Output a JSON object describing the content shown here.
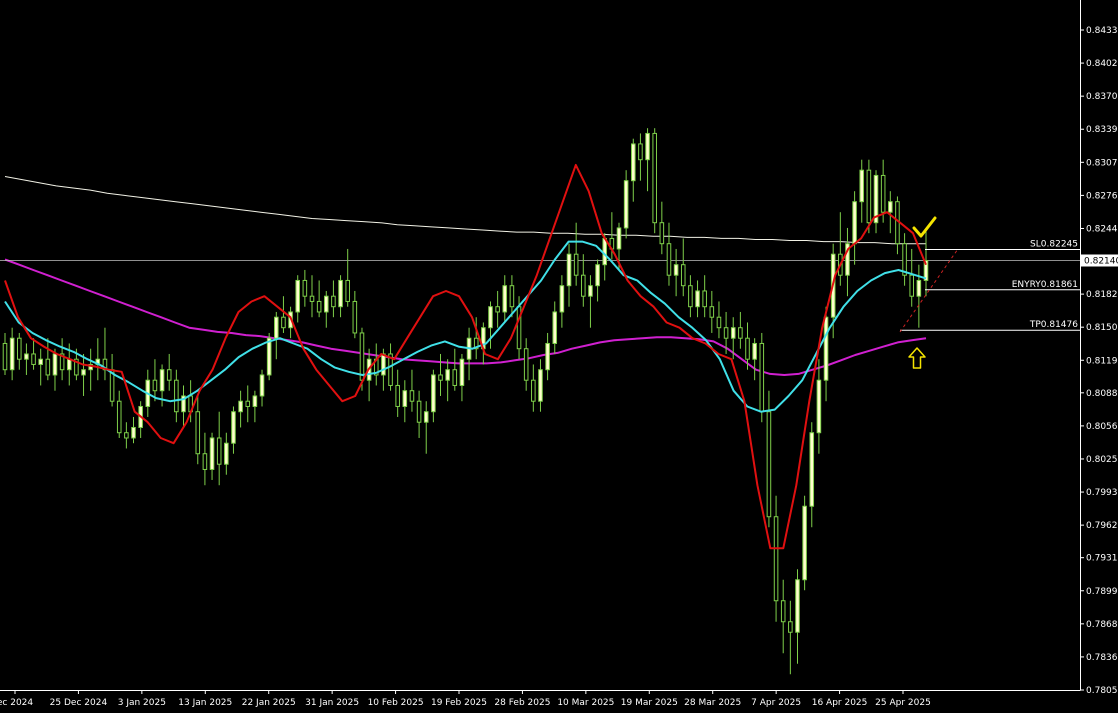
{
  "chart_data": {
    "type": "candlestick",
    "background": "#000000",
    "colors": {
      "bull_body": "#ffffcc",
      "bear_body": "#000000",
      "wick": "#7fd04a",
      "axis": "#ffffff",
      "ma_fast": "#e01010",
      "ma_mid": "#40e0e8",
      "ma_slow": "#d020d0",
      "ma_long": "#f2f2e6",
      "level_line": "#ffffff",
      "current_price_line": "#c0c0c0",
      "arrow": "#f5e400",
      "check": "#f5e400",
      "trend_dash": "#cc2222"
    },
    "price_axis": {
      "ticks": [
        "0.84335",
        "0.84020",
        "0.83705",
        "0.83390",
        "0.83075",
        "0.82760",
        "0.82445",
        "0.82140",
        "0.81820",
        "0.81505",
        "0.81190",
        "0.80880",
        "0.80565",
        "0.80250",
        "0.79935",
        "0.79620",
        "0.79310",
        "0.78995",
        "0.78680",
        "0.78365",
        "0.78050"
      ],
      "ylim": [
        0.7805,
        0.84335
      ]
    },
    "date_axis": {
      "ticks": [
        "ec 2024",
        "25 Dec 2024",
        "3 Jan 2025",
        "13 Jan 2025",
        "22 Jan 2025",
        "31 Jan 2025",
        "10 Feb 2025",
        "19 Feb 2025",
        "28 Feb 2025",
        "10 Mar 2025",
        "19 Mar 2025",
        "28 Mar 2025",
        "7 Apr 2025",
        "16 Apr 2025",
        "25 Apr 2025"
      ]
    },
    "current_price": "0.82140",
    "levels": [
      {
        "label": "SL0.82245",
        "value": 0.82245
      },
      {
        "label": "ENYRY0.81861",
        "value": 0.81861
      },
      {
        "label": "TP0.81476",
        "value": 0.81476
      }
    ],
    "candles": [
      [
        0.8135,
        0.8145,
        0.8105,
        0.811
      ],
      [
        0.811,
        0.815,
        0.81,
        0.814
      ],
      [
        0.814,
        0.8145,
        0.811,
        0.812
      ],
      [
        0.812,
        0.8135,
        0.8105,
        0.8125
      ],
      [
        0.8125,
        0.814,
        0.811,
        0.8115
      ],
      [
        0.8115,
        0.813,
        0.8095,
        0.812
      ],
      [
        0.812,
        0.814,
        0.81,
        0.8105
      ],
      [
        0.8105,
        0.813,
        0.809,
        0.8125
      ],
      [
        0.8125,
        0.814,
        0.81,
        0.811
      ],
      [
        0.811,
        0.8135,
        0.8095,
        0.812
      ],
      [
        0.812,
        0.813,
        0.81,
        0.8105
      ],
      [
        0.8105,
        0.8125,
        0.8085,
        0.811
      ],
      [
        0.811,
        0.813,
        0.809,
        0.8115
      ],
      [
        0.8115,
        0.814,
        0.81,
        0.812
      ],
      [
        0.812,
        0.815,
        0.81,
        0.811
      ],
      [
        0.811,
        0.8125,
        0.8075,
        0.808
      ],
      [
        0.808,
        0.809,
        0.8045,
        0.805
      ],
      [
        0.805,
        0.806,
        0.8035,
        0.8045
      ],
      [
        0.8045,
        0.8065,
        0.804,
        0.8055
      ],
      [
        0.8055,
        0.808,
        0.8045,
        0.8075
      ],
      [
        0.8075,
        0.811,
        0.8065,
        0.81
      ],
      [
        0.81,
        0.812,
        0.808,
        0.809
      ],
      [
        0.809,
        0.8115,
        0.8075,
        0.811
      ],
      [
        0.811,
        0.8125,
        0.809,
        0.81
      ],
      [
        0.81,
        0.811,
        0.806,
        0.807
      ],
      [
        0.807,
        0.8095,
        0.8055,
        0.8085
      ],
      [
        0.8085,
        0.81,
        0.806,
        0.807
      ],
      [
        0.807,
        0.8085,
        0.802,
        0.803
      ],
      [
        0.803,
        0.805,
        0.8,
        0.8015
      ],
      [
        0.8015,
        0.805,
        0.8005,
        0.8045
      ],
      [
        0.8045,
        0.807,
        0.8,
        0.802
      ],
      [
        0.802,
        0.805,
        0.801,
        0.804
      ],
      [
        0.804,
        0.8075,
        0.803,
        0.807
      ],
      [
        0.807,
        0.809,
        0.8055,
        0.808
      ],
      [
        0.808,
        0.8095,
        0.806,
        0.8075
      ],
      [
        0.8075,
        0.809,
        0.806,
        0.8085
      ],
      [
        0.8085,
        0.811,
        0.8075,
        0.8105
      ],
      [
        0.8105,
        0.8145,
        0.81,
        0.814
      ],
      [
        0.814,
        0.8165,
        0.812,
        0.816
      ],
      [
        0.816,
        0.818,
        0.8145,
        0.815
      ],
      [
        0.815,
        0.817,
        0.814,
        0.8165
      ],
      [
        0.8165,
        0.82,
        0.8155,
        0.8195
      ],
      [
        0.8195,
        0.8205,
        0.817,
        0.818
      ],
      [
        0.818,
        0.82,
        0.816,
        0.8175
      ],
      [
        0.8175,
        0.8195,
        0.816,
        0.8165
      ],
      [
        0.8165,
        0.8185,
        0.815,
        0.818
      ],
      [
        0.818,
        0.8195,
        0.816,
        0.817
      ],
      [
        0.817,
        0.82,
        0.816,
        0.8195
      ],
      [
        0.8195,
        0.8225,
        0.817,
        0.8175
      ],
      [
        0.8175,
        0.8185,
        0.814,
        0.8145
      ],
      [
        0.8145,
        0.815,
        0.809,
        0.81
      ],
      [
        0.81,
        0.813,
        0.808,
        0.812
      ],
      [
        0.812,
        0.8135,
        0.8095,
        0.8105
      ],
      [
        0.8105,
        0.813,
        0.809,
        0.8125
      ],
      [
        0.8125,
        0.8135,
        0.809,
        0.8095
      ],
      [
        0.8095,
        0.811,
        0.8065,
        0.8075
      ],
      [
        0.8075,
        0.81,
        0.806,
        0.809
      ],
      [
        0.809,
        0.811,
        0.807,
        0.808
      ],
      [
        0.808,
        0.809,
        0.8045,
        0.806
      ],
      [
        0.806,
        0.808,
        0.803,
        0.807
      ],
      [
        0.807,
        0.811,
        0.806,
        0.8105
      ],
      [
        0.8105,
        0.8125,
        0.8085,
        0.81
      ],
      [
        0.81,
        0.812,
        0.808,
        0.811
      ],
      [
        0.811,
        0.813,
        0.809,
        0.8095
      ],
      [
        0.8095,
        0.8125,
        0.808,
        0.812
      ],
      [
        0.812,
        0.815,
        0.81,
        0.814
      ],
      [
        0.814,
        0.816,
        0.812,
        0.813
      ],
      [
        0.813,
        0.8155,
        0.8115,
        0.815
      ],
      [
        0.815,
        0.8175,
        0.813,
        0.817
      ],
      [
        0.817,
        0.8185,
        0.815,
        0.8165
      ],
      [
        0.8165,
        0.82,
        0.8155,
        0.819
      ],
      [
        0.819,
        0.82,
        0.816,
        0.817
      ],
      [
        0.817,
        0.818,
        0.812,
        0.813
      ],
      [
        0.813,
        0.814,
        0.809,
        0.81
      ],
      [
        0.81,
        0.8115,
        0.807,
        0.808
      ],
      [
        0.808,
        0.812,
        0.807,
        0.811
      ],
      [
        0.811,
        0.8145,
        0.81,
        0.8135
      ],
      [
        0.8135,
        0.8175,
        0.8125,
        0.8165
      ],
      [
        0.8165,
        0.82,
        0.815,
        0.819
      ],
      [
        0.819,
        0.823,
        0.817,
        0.822
      ],
      [
        0.822,
        0.825,
        0.819,
        0.82
      ],
      [
        0.82,
        0.822,
        0.817,
        0.818
      ],
      [
        0.818,
        0.82,
        0.815,
        0.819
      ],
      [
        0.819,
        0.8215,
        0.8175,
        0.821
      ],
      [
        0.821,
        0.824,
        0.8195,
        0.8235
      ],
      [
        0.8235,
        0.826,
        0.8215,
        0.8225
      ],
      [
        0.8225,
        0.825,
        0.8205,
        0.8245
      ],
      [
        0.8245,
        0.83,
        0.8235,
        0.829
      ],
      [
        0.829,
        0.833,
        0.827,
        0.8325
      ],
      [
        0.8325,
        0.8335,
        0.829,
        0.831
      ],
      [
        0.831,
        0.834,
        0.828,
        0.8335
      ],
      [
        0.8335,
        0.834,
        0.824,
        0.825
      ],
      [
        0.825,
        0.827,
        0.822,
        0.823
      ],
      [
        0.823,
        0.825,
        0.819,
        0.82
      ],
      [
        0.82,
        0.8225,
        0.818,
        0.821
      ],
      [
        0.821,
        0.8235,
        0.818,
        0.819
      ],
      [
        0.819,
        0.82,
        0.816,
        0.817
      ],
      [
        0.817,
        0.8195,
        0.816,
        0.8185
      ],
      [
        0.8185,
        0.82,
        0.816,
        0.817
      ],
      [
        0.817,
        0.8185,
        0.8145,
        0.816
      ],
      [
        0.816,
        0.8175,
        0.814,
        0.815
      ],
      [
        0.815,
        0.8165,
        0.8125,
        0.814
      ],
      [
        0.814,
        0.816,
        0.812,
        0.815
      ],
      [
        0.815,
        0.8165,
        0.813,
        0.814
      ],
      [
        0.814,
        0.8155,
        0.811,
        0.812
      ],
      [
        0.812,
        0.814,
        0.81,
        0.8135
      ],
      [
        0.8135,
        0.8145,
        0.806,
        0.807
      ],
      [
        0.807,
        0.809,
        0.796,
        0.797
      ],
      [
        0.797,
        0.799,
        0.787,
        0.789
      ],
      [
        0.789,
        0.791,
        0.784,
        0.787
      ],
      [
        0.787,
        0.789,
        0.782,
        0.786
      ],
      [
        0.786,
        0.792,
        0.783,
        0.791
      ],
      [
        0.791,
        0.799,
        0.79,
        0.798
      ],
      [
        0.798,
        0.806,
        0.796,
        0.805
      ],
      [
        0.805,
        0.812,
        0.803,
        0.81
      ],
      [
        0.81,
        0.817,
        0.808,
        0.816
      ],
      [
        0.816,
        0.823,
        0.814,
        0.822
      ],
      [
        0.822,
        0.826,
        0.819,
        0.82
      ],
      [
        0.82,
        0.8245,
        0.818,
        0.823
      ],
      [
        0.823,
        0.828,
        0.821,
        0.827
      ],
      [
        0.827,
        0.831,
        0.825,
        0.83
      ],
      [
        0.83,
        0.831,
        0.824,
        0.825
      ],
      [
        0.825,
        0.83,
        0.824,
        0.8295
      ],
      [
        0.8295,
        0.831,
        0.825,
        0.826
      ],
      [
        0.826,
        0.828,
        0.824,
        0.827
      ],
      [
        0.827,
        0.8275,
        0.822,
        0.823
      ],
      [
        0.823,
        0.824,
        0.819,
        0.82
      ],
      [
        0.82,
        0.8225,
        0.817,
        0.818
      ],
      [
        0.818,
        0.821,
        0.815,
        0.8195
      ],
      [
        0.8195,
        0.8245,
        0.818,
        0.8214
      ]
    ],
    "ma_fast": [
      0.8195,
      0.816,
      0.814,
      0.8132,
      0.8125,
      0.812,
      0.8115,
      0.8113,
      0.811,
      0.8108,
      0.807,
      0.806,
      0.8045,
      0.804,
      0.806,
      0.809,
      0.811,
      0.814,
      0.8165,
      0.8175,
      0.818,
      0.817,
      0.816,
      0.813,
      0.811,
      0.8095,
      0.808,
      0.8085,
      0.811,
      0.8125,
      0.812,
      0.814,
      0.816,
      0.818,
      0.8185,
      0.818,
      0.816,
      0.8125,
      0.812,
      0.814,
      0.817,
      0.82,
      0.8235,
      0.827,
      0.8305,
      0.828,
      0.824,
      0.822,
      0.8195,
      0.818,
      0.817,
      0.8155,
      0.815,
      0.814,
      0.8135,
      0.8125,
      0.812,
      0.808,
      0.8,
      0.794,
      0.794,
      0.8,
      0.808,
      0.815,
      0.82,
      0.8225,
      0.8235,
      0.8255,
      0.826,
      0.825,
      0.824,
      0.821
    ],
    "ma_mid": [
      0.8175,
      0.8155,
      0.8145,
      0.8138,
      0.8132,
      0.8127,
      0.812,
      0.8114,
      0.8105,
      0.8098,
      0.809,
      0.8083,
      0.808,
      0.8082,
      0.809,
      0.81,
      0.811,
      0.8122,
      0.813,
      0.8136,
      0.814,
      0.8135,
      0.813,
      0.812,
      0.8112,
      0.8108,
      0.8105,
      0.8107,
      0.8113,
      0.812,
      0.8127,
      0.8133,
      0.8137,
      0.8132,
      0.813,
      0.8135,
      0.815,
      0.8165,
      0.818,
      0.8195,
      0.8215,
      0.8232,
      0.8232,
      0.8228,
      0.8215,
      0.82,
      0.8195,
      0.8183,
      0.8173,
      0.816,
      0.815,
      0.8138,
      0.812,
      0.809,
      0.8075,
      0.807,
      0.8072,
      0.8085,
      0.81,
      0.8125,
      0.815,
      0.817,
      0.8185,
      0.8195,
      0.8202,
      0.8205,
      0.8201,
      0.8197
    ],
    "ma_slow": [
      0.8215,
      0.821,
      0.8205,
      0.82,
      0.8195,
      0.819,
      0.8185,
      0.818,
      0.8175,
      0.817,
      0.8165,
      0.816,
      0.8155,
      0.815,
      0.8148,
      0.8146,
      0.8145,
      0.8143,
      0.8142,
      0.814,
      0.8138,
      0.8136,
      0.8133,
      0.813,
      0.8128,
      0.8126,
      0.8124,
      0.8122,
      0.812,
      0.8119,
      0.8118,
      0.8117,
      0.8116,
      0.8116,
      0.8116,
      0.8117,
      0.8119,
      0.8121,
      0.8124,
      0.8126,
      0.813,
      0.8133,
      0.8136,
      0.8138,
      0.8139,
      0.814,
      0.8141,
      0.8141,
      0.814,
      0.8139,
      0.8137,
      0.813,
      0.812,
      0.811,
      0.8106,
      0.8105,
      0.8106,
      0.811,
      0.8114,
      0.8119,
      0.8124,
      0.8128,
      0.8132,
      0.8136,
      0.8138,
      0.814
    ],
    "ma_long": [
      0.8294,
      0.8291,
      0.8288,
      0.8285,
      0.8283,
      0.8281,
      0.8278,
      0.8276,
      0.8274,
      0.8272,
      0.827,
      0.8268,
      0.8266,
      0.8264,
      0.8262,
      0.826,
      0.8258,
      0.8256,
      0.8254,
      0.8253,
      0.8252,
      0.8251,
      0.825,
      0.8248,
      0.8247,
      0.8246,
      0.8245,
      0.8244,
      0.8243,
      0.8242,
      0.8241,
      0.8241,
      0.824,
      0.824,
      0.8239,
      0.8239,
      0.8238,
      0.8238,
      0.8237,
      0.8237,
      0.8236,
      0.8236,
      0.8235,
      0.8235,
      0.8234,
      0.8234,
      0.8233,
      0.8233,
      0.8232,
      0.8232,
      0.8231,
      0.8231,
      0.823,
      0.823,
      0.823
    ]
  }
}
